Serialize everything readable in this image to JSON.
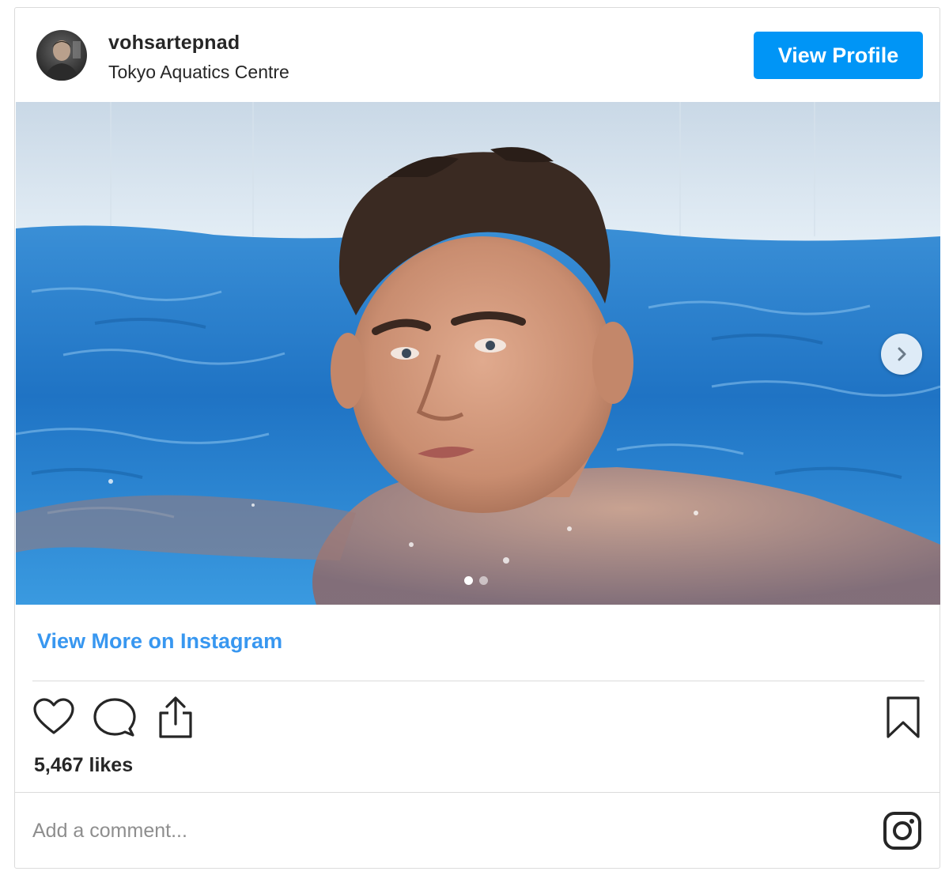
{
  "header": {
    "username": "vohsartepnad",
    "location": "Tokyo Aquatics Centre",
    "view_profile_label": "View Profile"
  },
  "media": {
    "carousel_count": 2,
    "carousel_active_index": 0,
    "next_icon": "chevron-right-icon"
  },
  "links": {
    "view_more_label": "View More on Instagram"
  },
  "actions": {
    "icons": [
      "heart-icon",
      "comment-icon",
      "share-icon",
      "bookmark-icon"
    ]
  },
  "likes": {
    "text": "5,467 likes"
  },
  "comment": {
    "placeholder": "Add a comment...",
    "value": ""
  },
  "footer": {
    "logo_icon": "instagram-icon"
  },
  "colors": {
    "accent": "#0095f6",
    "link": "#3897f0",
    "border": "#dbdbdb",
    "text": "#262626",
    "muted": "#8e8e8e"
  }
}
